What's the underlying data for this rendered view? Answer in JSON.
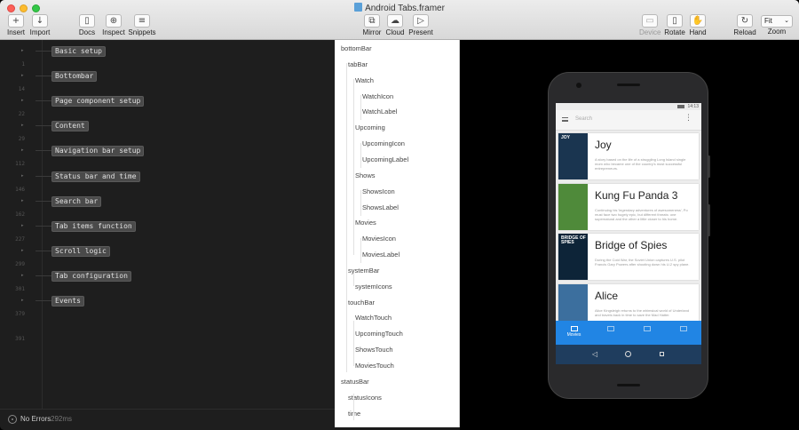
{
  "window": {
    "title": "Android Tabs.framer"
  },
  "toolbar": {
    "insert": "Insert",
    "import": "Import",
    "docs": "Docs",
    "inspect": "Inspect",
    "snippets": "Snippets",
    "mirror": "Mirror",
    "cloud": "Cloud",
    "present": "Present",
    "device": "Device",
    "rotate": "Rotate",
    "hand": "Hand",
    "reload": "Reload",
    "zoom": "Zoom",
    "zoom_value": "Fit"
  },
  "editor": {
    "folds": [
      {
        "line": "1",
        "label": "Basic setup"
      },
      {
        "line": "14",
        "label": "Bottombar"
      },
      {
        "line": "22",
        "label": "Page component setup"
      },
      {
        "line": "29",
        "label": "Content"
      },
      {
        "line": "112",
        "label": "Navigation bar setup"
      },
      {
        "line": "146",
        "label": "Status bar and time"
      },
      {
        "line": "162",
        "label": "Search bar"
      },
      {
        "line": "227",
        "label": "Tab items function"
      },
      {
        "line": "299",
        "label": "Scroll logic"
      },
      {
        "line": "301",
        "label": "Tab configuration"
      },
      {
        "line": "379",
        "label": "Events"
      },
      {
        "line": "391",
        "label": ""
      }
    ],
    "status": {
      "errors": "No Errors",
      "time": "292ms"
    }
  },
  "layers": [
    {
      "label": "bottomBar",
      "depth": 0
    },
    {
      "label": "tabBar",
      "depth": 1
    },
    {
      "label": "Watch",
      "depth": 2
    },
    {
      "label": "WatchIcon",
      "depth": 3
    },
    {
      "label": "WatchLabel",
      "depth": 3
    },
    {
      "label": "Upcoming",
      "depth": 2
    },
    {
      "label": "UpcomingIcon",
      "depth": 3
    },
    {
      "label": "UpcomingLabel",
      "depth": 3
    },
    {
      "label": "Shows",
      "depth": 2
    },
    {
      "label": "ShowsIcon",
      "depth": 3
    },
    {
      "label": "ShowsLabel",
      "depth": 3
    },
    {
      "label": "Movies",
      "depth": 2
    },
    {
      "label": "MoviesIcon",
      "depth": 3
    },
    {
      "label": "MoviesLabel",
      "depth": 3
    },
    {
      "label": "systemBar",
      "depth": 1
    },
    {
      "label": "systemIcons",
      "depth": 2
    },
    {
      "label": "touchBar",
      "depth": 1
    },
    {
      "label": "WatchTouch",
      "depth": 2
    },
    {
      "label": "UpcomingTouch",
      "depth": 2
    },
    {
      "label": "ShowsTouch",
      "depth": 2
    },
    {
      "label": "MoviesTouch",
      "depth": 2
    },
    {
      "label": "statusBar",
      "depth": 0
    },
    {
      "label": "statusIcons",
      "depth": 1
    },
    {
      "label": "time",
      "depth": 1
    }
  ],
  "device": {
    "status_time": "14:13",
    "search_placeholder": "Search",
    "movies": [
      {
        "title": "Joy",
        "poster_text": "JOY",
        "poster_color": "#1a3550",
        "desc": "A story based on the life of a struggling Long Island single mom who became one of the country's most successful entrepreneurs."
      },
      {
        "title": "Kung Fu Panda 3",
        "poster_text": "",
        "poster_color": "#4f8a3a",
        "desc": "Continuing his 'legendary adventures of awesomeness', Po must face two hugely epic, but different threats: one supernatural and the other a little closer to his home."
      },
      {
        "title": "Bridge of Spies",
        "poster_text": "BRIDGE OF SPIES",
        "poster_color": "#0d2438",
        "desc": "During the Cold War, the Soviet Union captures U.S. pilot Francis Gary Powers after shooting down his U-2 spy plane."
      },
      {
        "title": "Alice",
        "poster_text": "",
        "poster_color": "#3c6f9e",
        "desc": "Alice Kingsleigh returns to the whimsical world of Underland and travels back in time to save the Mad Hatter."
      }
    ],
    "tabs": [
      {
        "label": "Movies",
        "active": true
      },
      {
        "label": "",
        "active": false
      },
      {
        "label": "",
        "active": false
      },
      {
        "label": "",
        "active": false
      }
    ],
    "accent_color": "#2185e4"
  }
}
